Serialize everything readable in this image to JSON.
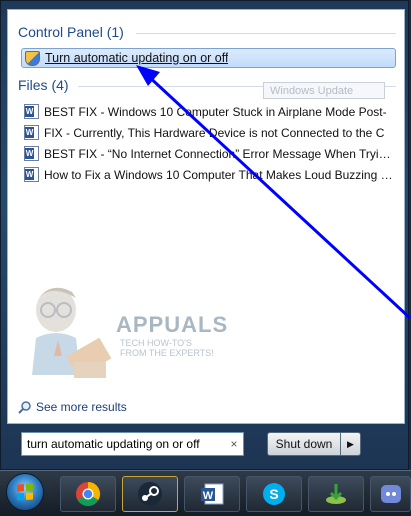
{
  "results": {
    "control_panel": {
      "header": "Control Panel (1)",
      "items": [
        {
          "label": "Turn automatic updating on or off"
        }
      ]
    },
    "files": {
      "header": "Files (4)",
      "items": [
        {
          "label": "BEST FIX - Windows 10 Computer Stuck in Airplane Mode Post-"
        },
        {
          "label": "FIX - Currently, This Hardware Device is not Connected to the C"
        },
        {
          "label": "BEST FIX - “No Internet Connection” Error Message When Tryin…"
        },
        {
          "label": "How to Fix a Windows 10 Computer That Makes Loud Buzzing …"
        }
      ]
    },
    "tooltip": "Windows Update"
  },
  "watermark": {
    "name": "APPUALS",
    "tagline": "TECH HOW-TO'S FROM THE EXPERTS!"
  },
  "see_more": "See more results",
  "search": {
    "value": "turn automatic updating on or off",
    "clear_icon": "×"
  },
  "shutdown": {
    "label": "Shut down",
    "arrow": "▶"
  },
  "taskbar": {
    "apps": [
      "start-orb",
      "chrome-icon",
      "steam-icon",
      "word-icon",
      "skype-icon",
      "download-manager-icon",
      "discord-icon"
    ]
  },
  "annotation": {
    "arrow_color": "#0000ff"
  }
}
